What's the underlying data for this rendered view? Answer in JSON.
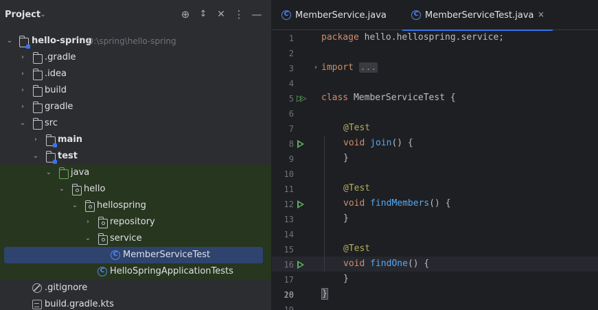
{
  "project": {
    "title": "Project",
    "header_icons": [
      "target-icon",
      "expand-collapse-icon",
      "close-all-icon",
      "more-icon",
      "minimize-icon"
    ],
    "tree": [
      {
        "label": "hello-spring",
        "hint": "D:\\spring\\hello-spring",
        "icon": "module-folder-icon",
        "expanded": true,
        "bold": true
      },
      {
        "label": ".gradle",
        "icon": "folder-icon",
        "expanded": false
      },
      {
        "label": ".idea",
        "icon": "folder-icon",
        "expanded": false
      },
      {
        "label": "build",
        "icon": "folder-icon",
        "expanded": false
      },
      {
        "label": "gradle",
        "icon": "folder-icon",
        "expanded": false
      },
      {
        "label": "src",
        "icon": "folder-icon",
        "expanded": true
      },
      {
        "label": "main",
        "icon": "module-folder-icon",
        "expanded": false,
        "bold": true
      },
      {
        "label": "test",
        "icon": "module-folder-icon",
        "expanded": true,
        "bold": true
      },
      {
        "label": "java",
        "icon": "test-source-folder-icon",
        "expanded": true
      },
      {
        "label": "hello",
        "icon": "package-icon",
        "expanded": true
      },
      {
        "label": "hellospring",
        "icon": "package-icon",
        "expanded": true
      },
      {
        "label": "repository",
        "icon": "package-icon",
        "expanded": false
      },
      {
        "label": "service",
        "icon": "package-icon",
        "expanded": true
      },
      {
        "label": "MemberServiceTest",
        "icon": "class-icon",
        "selected": true
      },
      {
        "label": "HelloSpringApplicationTests",
        "icon": "class-icon"
      },
      {
        "label": ".gitignore",
        "icon": "gitignore-icon"
      },
      {
        "label": "build.gradle.kts",
        "icon": "gradle-kts-icon"
      }
    ]
  },
  "editor": {
    "tabs": [
      {
        "label": "MemberService.java",
        "active": false
      },
      {
        "label": "MemberServiceTest.java",
        "active": true,
        "close": "×"
      }
    ],
    "line_numbers": [
      "1",
      "2",
      "3",
      "4",
      "5",
      "6",
      "7",
      "8",
      "9",
      "10",
      "11",
      "12",
      "13",
      "14",
      "15",
      "16",
      "17",
      "18",
      "19",
      "20"
    ],
    "code": {
      "l1_kw": "package",
      "l1_rest": " hello.hellospring.service;",
      "l3_kw": "import",
      "l3_fold": "...",
      "l7_kw": "class",
      "l7_name": " MemberServiceTest ",
      "l7_brace": "{",
      "l9_an": "@Test",
      "l10_kw": "void",
      "l10_fn": "join",
      "l10_rest": "() {",
      "l11": "}",
      "l13_an": "@Test",
      "l14_kw": "void",
      "l14_fn": "findMembers",
      "l14_rest": "() {",
      "l15": "}",
      "l17_an": "@Test",
      "l18_kw": "void",
      "l18_fn": "findOne",
      "l18_rest": "() {",
      "l19": "}",
      "l20": "}"
    }
  }
}
